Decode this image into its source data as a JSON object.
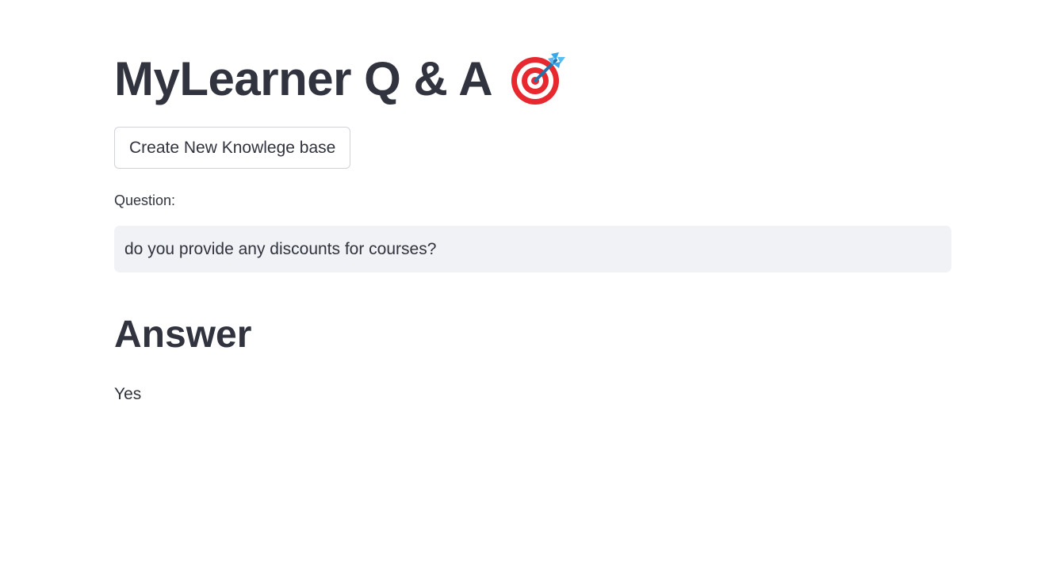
{
  "header": {
    "title": "MyLearner Q & A",
    "title_icon": "direct-hit-target-icon"
  },
  "actions": {
    "create_kb_label": "Create New Knowlege base"
  },
  "question": {
    "label": "Question:",
    "value": "do you provide any discounts for courses?"
  },
  "answer": {
    "heading": "Answer",
    "text": "Yes"
  },
  "colors": {
    "text": "#31333f",
    "input_bg": "#f0f2f6",
    "target_red": "#e8282f",
    "dart_blue": "#3aa7e8"
  }
}
